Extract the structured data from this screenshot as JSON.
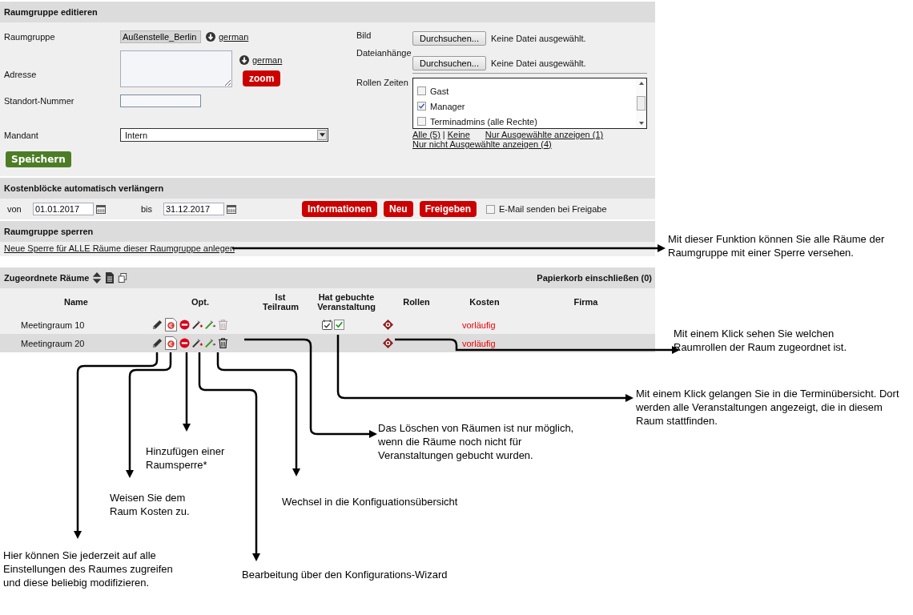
{
  "edit_section": {
    "title": "Raumgruppe editieren",
    "raumgruppe": {
      "label": "Raumgruppe",
      "value": "Außenstelle_Berlin",
      "language_link": "german"
    },
    "adresse": {
      "label": "Adresse",
      "language_link": "german",
      "zoom_button": "zoom"
    },
    "standort": {
      "label": "Standort-Nummer"
    },
    "mandant": {
      "label": "Mandant",
      "value": "Intern"
    },
    "save_button": "Speichern",
    "uploads": [
      {
        "label": "Bild",
        "button": "Durchsuchen...",
        "status": "Keine Datei ausgewählt."
      },
      {
        "label": "Dateianhänge",
        "button": "Durchsuchen...",
        "status": "Keine Datei ausgewählt."
      }
    ],
    "roles": {
      "label": "Rollen Zeiten",
      "items": [
        {
          "label": "Gast",
          "checked": false
        },
        {
          "label": "Manager",
          "checked": true
        },
        {
          "label": "Terminadmins (alle Rechte)",
          "checked": false
        }
      ],
      "all_link": "Alle (5)",
      "separator": "|",
      "none_link": "Keine",
      "selected_link": "Nur Ausgewählte anzeigen (1)",
      "unselected_link": "Nur nicht Ausgewählte anzeigen (4)"
    }
  },
  "cost_section": {
    "title": "Kostenblöcke automatisch verlängern",
    "from_label": "von",
    "from": "01.01.2017",
    "to_label": "bis",
    "to": "31.12.2017",
    "buttons": [
      "Informationen",
      "Neu",
      "Freigeben"
    ],
    "email": {
      "label": "E-Mail senden bei Freigabe",
      "checked": false
    }
  },
  "lock_section": {
    "title": "Raumgruppe sperren",
    "link": "Neue Sperre für ALLE Räume dieser Raumgruppe anlegen"
  },
  "rooms_section": {
    "title": "Zugeordnete Räume",
    "trash_toggle": "Papierkorb einschließen (0)",
    "columns": [
      "Name",
      "Opt.",
      "Ist Teilraum",
      "Hat gebuchte Veranstaltung",
      "Rollen",
      "Kosten",
      "Firma"
    ],
    "rows": [
      {
        "name": "Meetingraum 10",
        "delete_enabled": false,
        "has_booking": true,
        "kosten": "vorläufig",
        "highlighted": false
      },
      {
        "name": "Meetingraum 20",
        "delete_enabled": true,
        "has_booking": false,
        "kosten": "vorläufig",
        "highlighted": true
      }
    ]
  },
  "annotations": [
    "Mit dieser Funktion können Sie alle Räume der Raumgruppe mit einer Sperre versehen.",
    "Mit einem Klick sehen Sie welchen Raumrollen der Raum zugeordnet ist.",
    "Mit einem Klick gelangen Sie in die Terminübersicht. Dort werden alle Veranstaltungen angezeigt, die in diesem Raum stattfinden.",
    "Das Löschen von Räumen ist nur möglich, wenn die Räume noch nicht für Veranstaltungen gebucht wurden.",
    "Hinzufügen einer Raumsperre*",
    "Weisen Sie dem Raum Kosten zu.",
    "Wechsel in die Konfiguationsübersicht",
    "Hier können Sie jederzeit auf alle Einstellungen des Raumes zugreifen und diese beliebig modifizieren.",
    "Bearbeitung über den Konfigurations-Wizard"
  ]
}
